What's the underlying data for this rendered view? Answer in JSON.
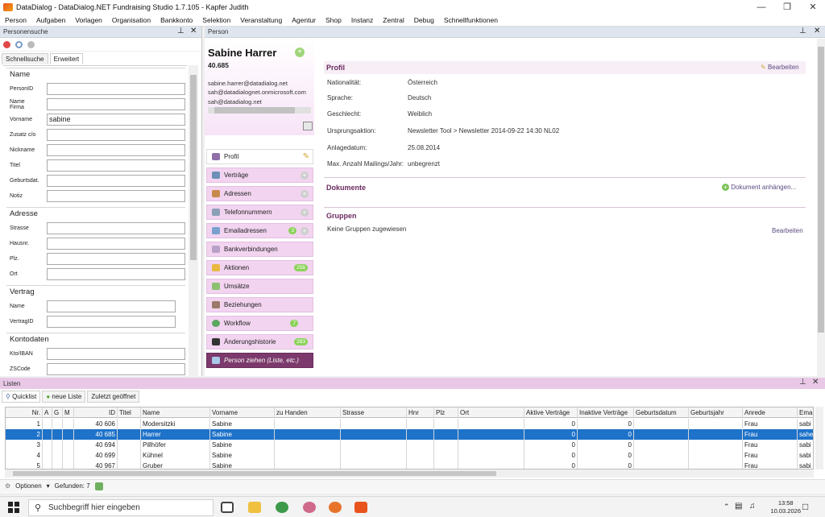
{
  "window": {
    "title": "DataDialog - DataDialog.NET Fundraising Studio 1.7.105 - Kapfer Judith"
  },
  "menu": [
    "Person",
    "Aufgaben",
    "Vorlagen",
    "Organisation",
    "Bankkonto",
    "Selektion",
    "Veranstaltung",
    "Agentur",
    "Shop",
    "Instanz",
    "Zentral",
    "Debug",
    "Schnellfunktionen"
  ],
  "search_panel": {
    "title": "Personensuche",
    "tabs": [
      "Schnellsuche",
      "Erweitert"
    ],
    "groups": {
      "name": {
        "title": "Name",
        "fields": {
          "personid": "PersonID",
          "namefirma": "Name Firma",
          "vorname": "Vorname",
          "vorname_value": "sabine",
          "zusatz": "Zusatz c/o",
          "nickname": "Nickname",
          "titel": "Titel",
          "geburtsdat": "Geburtsdat.",
          "notiz": "Notiz"
        }
      },
      "adresse": {
        "title": "Adresse",
        "fields": {
          "strasse": "Strasse",
          "hausnr": "Hausnr.",
          "plz": "Plz.",
          "ort": "Ort"
        }
      },
      "vertrag": {
        "title": "Vertrag",
        "fields": {
          "name": "Name",
          "vertragid": "VertragID"
        }
      },
      "kontodaten": {
        "title": "Kontodaten",
        "fields": {
          "kto": "Kto/IBAN",
          "zscode": "ZSCode"
        }
      }
    }
  },
  "person": {
    "panel_title": "Person",
    "name": "Sabine Harrer",
    "id": "40.685",
    "emails": [
      "sabine.harrer@datadialog.net",
      "sah@datadialognet.onmicrosoft.com",
      "sah@datadialog.net"
    ],
    "nav": {
      "profil": "Profil",
      "vertraege": "Verträge",
      "adressen": "Adressen",
      "telefon": "Telefonnummern",
      "email": "Emailadressen",
      "email_badge": "3",
      "bank": "Bankverbindungen",
      "aktionen": "Aktionen",
      "aktionen_badge": "256",
      "umsaetze": "Umsätze",
      "beziehungen": "Beziehungen",
      "workflow": "Workflow",
      "workflow_badge": "7",
      "historie": "Änderungshistorie",
      "historie_badge": "283",
      "ziehen": "Person ziehen (Liste, etc.)"
    },
    "profile": {
      "title": "Profil",
      "edit": "Bearbeiten",
      "rows": {
        "nat_k": "Nationalität:",
        "nat_v": "Österreich",
        "spr_k": "Sprache:",
        "spr_v": "Deutsch",
        "ges_k": "Geschlecht:",
        "ges_v": "Weiblich",
        "urs_k": "Ursprungsaktion:",
        "urs_v": "Newsletter Tool  >  Newsletter 2014-09-22 14:30 NL02",
        "anl_k": "Anlagedatum:",
        "anl_v": "25.08.2014",
        "max_k": "Max. Anzahl Mailings/Jahr:",
        "max_v": "unbegrenzt"
      }
    },
    "dokumente": {
      "title": "Dokumente",
      "attach": "Dokument anhängen..."
    },
    "gruppen": {
      "title": "Gruppen",
      "empty": "Keine Gruppen zugewiesen",
      "edit": "Bearbeiten"
    }
  },
  "lists": {
    "title": "Listen",
    "tabs": [
      "Quicklist",
      "neue Liste",
      "Zuletzt geöffnet"
    ],
    "columns": {
      "nr": "Nr.",
      "a": "A",
      "g": "G",
      "m": "M",
      "id": "ID",
      "titel": "Titel",
      "name": "Name",
      "vorname": "Vorname",
      "zuhanden": "zu Handen",
      "strasse": "Strasse",
      "hnr": "Hnr",
      "plz": "Plz",
      "ort": "Ort",
      "aktiv": "Aktive Verträge",
      "inaktiv": "Inaktive Verträge",
      "gebdat": "Geburtsdatum",
      "gebjahr": "Geburtsjahr",
      "anrede": "Anrede",
      "email": "Ema"
    },
    "rows": [
      {
        "nr": "1",
        "id": "40 606",
        "name": "Modersitzki",
        "vorname": "Sabine",
        "aktiv": "0",
        "inaktiv": "0",
        "anrede": "Frau",
        "email": "sabi"
      },
      {
        "nr": "2",
        "id": "40 685",
        "name": "Harrer",
        "vorname": "Sabine",
        "aktiv": "0",
        "inaktiv": "0",
        "anrede": "Frau",
        "email": "sahe"
      },
      {
        "nr": "3",
        "id": "40 694",
        "name": "Pillhöfer",
        "vorname": "Sabine",
        "aktiv": "0",
        "inaktiv": "0",
        "anrede": "Frau",
        "email": "sabi"
      },
      {
        "nr": "4",
        "id": "40 699",
        "name": "Kühnel",
        "vorname": "Sabine",
        "aktiv": "0",
        "inaktiv": "0",
        "anrede": "Frau",
        "email": "sabi"
      },
      {
        "nr": "5",
        "id": "40 967",
        "name": "Gruber",
        "vorname": "Sabine",
        "aktiv": "0",
        "inaktiv": "0",
        "anrede": "Frau",
        "email": "sabi"
      }
    ],
    "status": {
      "optionen": "Optionen",
      "gefunden": "Gefunden: 7"
    }
  },
  "taskbar": {
    "search_placeholder": "Suchbegriff hier eingeben",
    "time": "13:58",
    "date": "10.03.2026"
  },
  "colors": {
    "accent": "#7b3a6b",
    "nav_bg": "#f2d4f0",
    "selection": "#1e72c9",
    "section_title": "#6b2b5f"
  }
}
